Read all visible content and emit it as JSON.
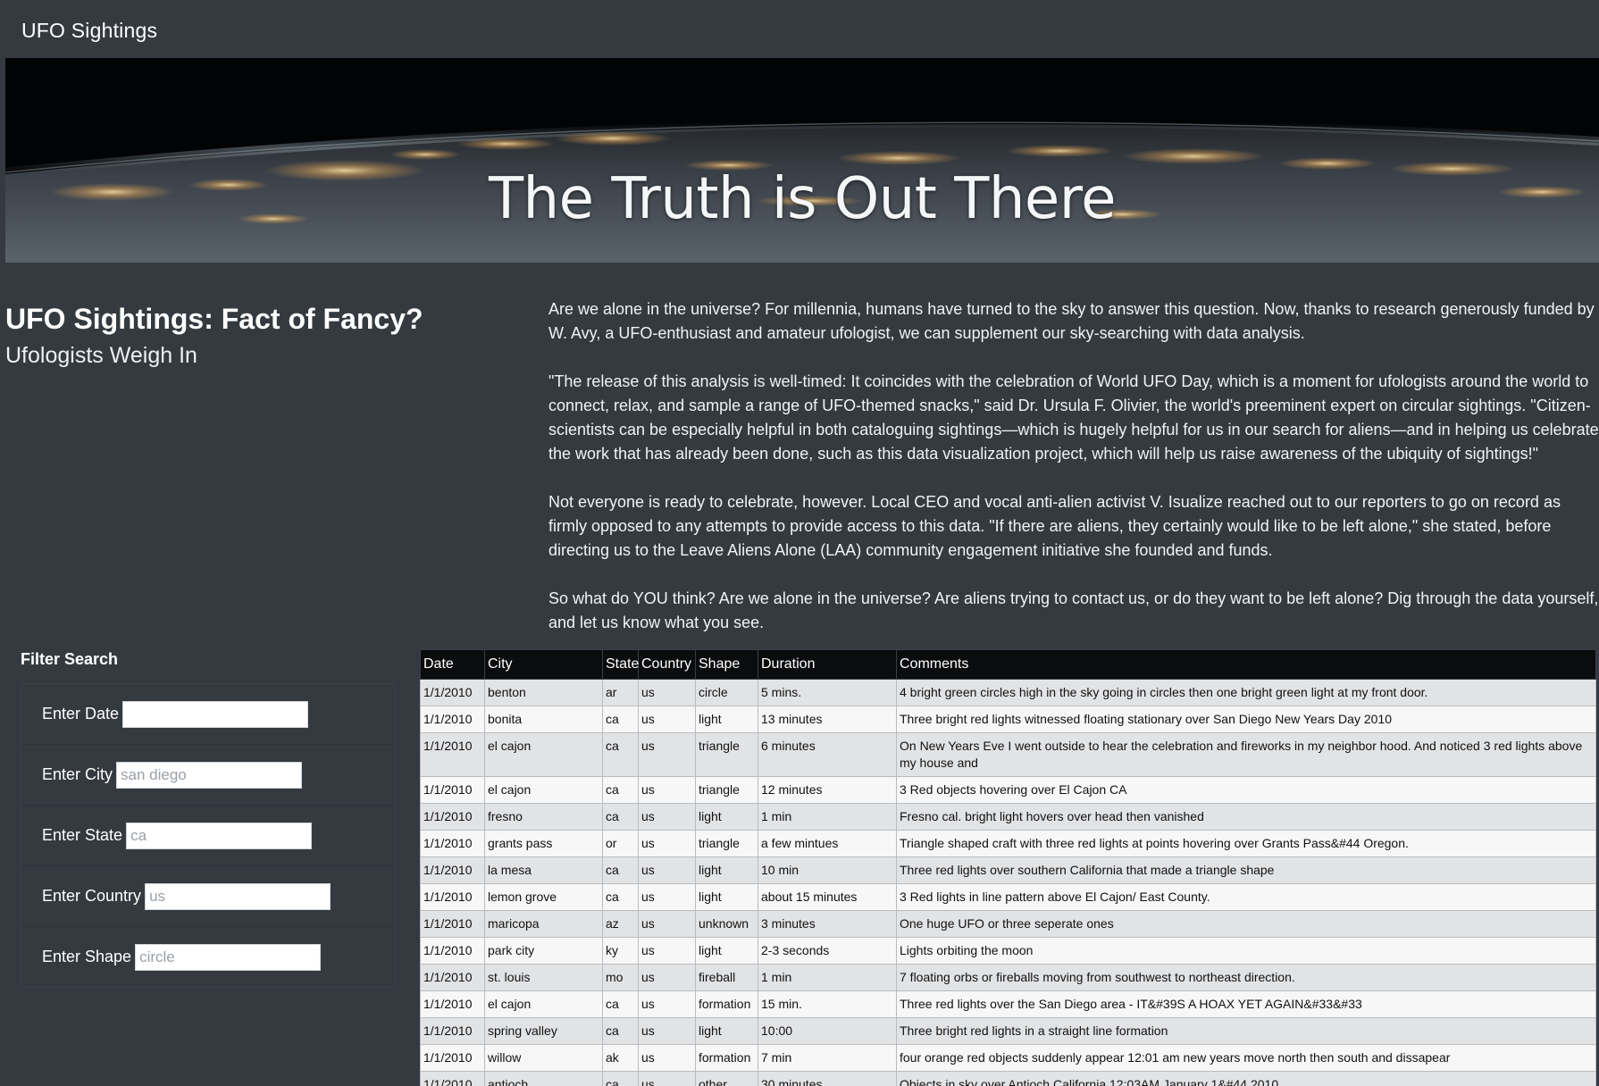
{
  "navbar": {
    "brand": "UFO Sightings"
  },
  "hero": {
    "title": "The Truth is Out There"
  },
  "article": {
    "heading_main": "UFO Sightings: Fact of Fancy?",
    "heading_sub": "Ufologists Weigh In",
    "paragraphs": [
      "Are we alone in the universe? For millennia, humans have turned to the sky to answer this question. Now, thanks to research generously funded by W. Avy, a UFO-enthusiast and amateur ufologist, we can supplement our sky-searching with data analysis.",
      "\"The release of this analysis is well-timed: It coincides with the celebration of World UFO Day, which is a moment for ufologists around the world to connect, relax, and sample a range of UFO-themed snacks,\" said Dr. Ursula F. Olivier, the world's preeminent expert on circular sightings. \"Citizen-scientists can be especially helpful in both cataloguing sightings—which is hugely helpful for us in our search for aliens—and in helping us celebrate the work that has already been done, such as this data visualization project, which will help us raise awareness of the ubiquity of sightings!\"",
      "Not everyone is ready to celebrate, however. Local CEO and vocal anti-alien activist V. Isualize reached out to our reporters to go on record as firmly opposed to any attempts to provide access to this data. \"If there are aliens, they certainly would like to be left alone,\" she stated, before directing us to the Leave Aliens Alone (LAA) community engagement initiative she founded and funds.",
      "So what do YOU think? Are we alone in the universe? Are aliens trying to contact us, or do they want to be left alone? Dig through the data yourself, and let us know what you see."
    ]
  },
  "filters": {
    "title": "Filter Search",
    "items": [
      {
        "label": "Enter Date",
        "placeholder": "",
        "value": ""
      },
      {
        "label": "Enter City",
        "placeholder": "san diego",
        "value": ""
      },
      {
        "label": "Enter State",
        "placeholder": "ca",
        "value": ""
      },
      {
        "label": "Enter Country",
        "placeholder": "us",
        "value": ""
      },
      {
        "label": "Enter Shape",
        "placeholder": "circle",
        "value": ""
      }
    ]
  },
  "table": {
    "columns": [
      "Date",
      "City",
      "State",
      "Country",
      "Shape",
      "Duration",
      "Comments"
    ],
    "rows": [
      [
        "1/1/2010",
        "benton",
        "ar",
        "us",
        "circle",
        "5 mins.",
        "4 bright green circles high in the sky going in circles then one bright green light at my front door."
      ],
      [
        "1/1/2010",
        "bonita",
        "ca",
        "us",
        "light",
        "13 minutes",
        "Three bright red lights witnessed floating stationary over San Diego New Years Day 2010"
      ],
      [
        "1/1/2010",
        "el cajon",
        "ca",
        "us",
        "triangle",
        "6 minutes",
        "On New Years Eve I went outside to hear the celebration and fireworks in my neighbor hood. And noticed 3 red lights above my house and"
      ],
      [
        "1/1/2010",
        "el cajon",
        "ca",
        "us",
        "triangle",
        "12 minutes",
        "3 Red objects hovering over El Cajon CA"
      ],
      [
        "1/1/2010",
        "fresno",
        "ca",
        "us",
        "light",
        "1 min",
        "Fresno cal. bright light hovers over head then vanished"
      ],
      [
        "1/1/2010",
        "grants pass",
        "or",
        "us",
        "triangle",
        "a few mintues",
        "Triangle shaped craft with three red lights at points hovering over Grants Pass&#44 Oregon."
      ],
      [
        "1/1/2010",
        "la mesa",
        "ca",
        "us",
        "light",
        "10 min",
        "Three red lights over southern California that made a triangle shape"
      ],
      [
        "1/1/2010",
        "lemon grove",
        "ca",
        "us",
        "light",
        "about 15 minutes",
        "3 Red lights in line pattern above El Cajon/ East County."
      ],
      [
        "1/1/2010",
        "maricopa",
        "az",
        "us",
        "unknown",
        "3 minutes",
        "One huge UFO or three seperate ones"
      ],
      [
        "1/1/2010",
        "park city",
        "ky",
        "us",
        "light",
        "2-3 seconds",
        "Lights orbiting the moon"
      ],
      [
        "1/1/2010",
        "st. louis",
        "mo",
        "us",
        "fireball",
        "1 min",
        "7 floating orbs or fireballs moving from southwest to northeast direction."
      ],
      [
        "1/1/2010",
        "el cajon",
        "ca",
        "us",
        "formation",
        "15 min.",
        "Three red lights over the San Diego area - IT&#39S A HOAX YET AGAIN&#33&#33"
      ],
      [
        "1/1/2010",
        "spring valley",
        "ca",
        "us",
        "light",
        "10:00",
        "Three bright red lights in a straight line formation"
      ],
      [
        "1/1/2010",
        "willow",
        "ak",
        "us",
        "formation",
        "7 min",
        "four orange red objects suddenly appear 12:01 am new years move north then south and dissapear"
      ],
      [
        "1/1/2010",
        "antioch",
        "ca",
        "us",
        "other",
        "30 minutes",
        "Objects in sky over Antioch California 12:03AM January 1&#44 2010"
      ]
    ]
  }
}
